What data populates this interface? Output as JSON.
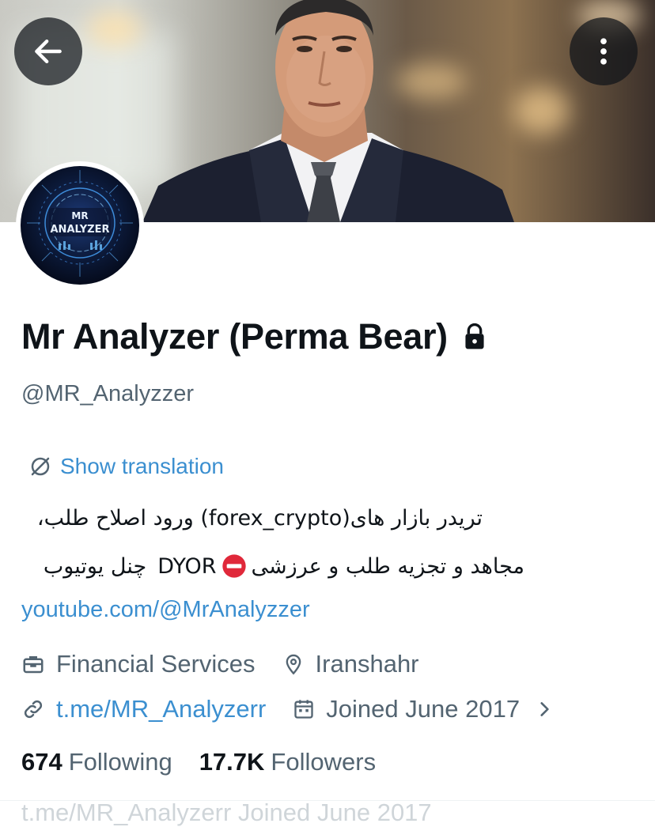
{
  "profile": {
    "display_name": "Mr Analyzer (Perma Bear)",
    "handle": "@MR_Analyzzer",
    "avatar_text_top": "MR",
    "avatar_text_bottom": "ANALYZER",
    "protected": true
  },
  "translation": {
    "label": "Show translation"
  },
  "bio": {
    "line1": "تریدر بازار های(forex_crypto) ورود اصلاح طلب،",
    "line2_part1": "مجاهد و تجزیه طلب و عرزشی",
    "line2_part2": "DYOR",
    "line2_part3": "چنل یوتیوب",
    "link": "youtube.com/@MrAnalyzzer"
  },
  "meta": {
    "category": "Financial Services",
    "location": "Iranshahr",
    "website": "t.me/MR_Analyzerr",
    "joined": "Joined June 2017"
  },
  "stats": {
    "following_count": "674",
    "following_label": "Following",
    "followers_count": "17.7K",
    "followers_label": "Followers"
  },
  "ghost_row": {
    "text": "t.me/MR_Analyzerr    Joined June 2017"
  },
  "icons": {
    "back": "arrow-left-icon",
    "more": "more-vertical-icon",
    "lock": "lock-icon",
    "translate": "translate-icon",
    "briefcase": "briefcase-icon",
    "location": "location-pin-icon",
    "link": "link-icon",
    "calendar": "calendar-icon",
    "chevron": "chevron-right-icon",
    "stop": "no-entry-emoji"
  },
  "colors": {
    "link": "#3b8fd0",
    "secondary_text": "#536471",
    "primary_text": "#0f1419",
    "avatar_bg": "#0c1a3a"
  }
}
